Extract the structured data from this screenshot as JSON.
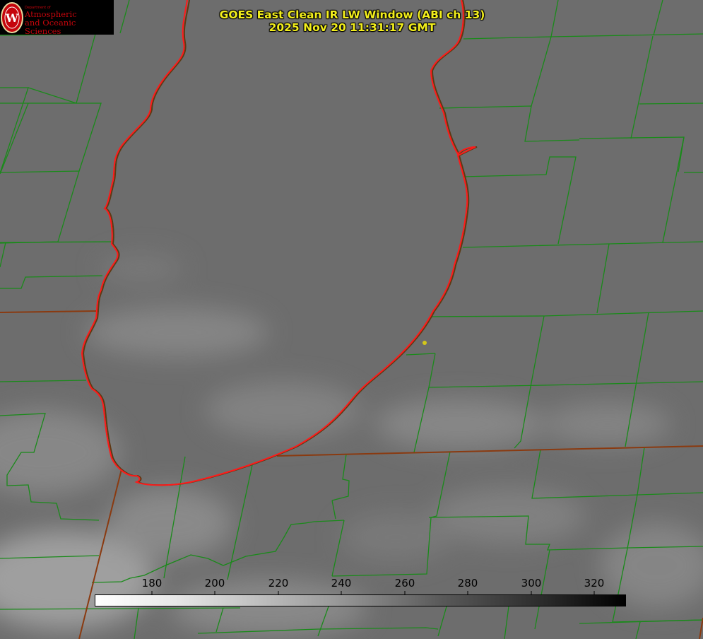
{
  "header": {
    "title_line1": "GOES East Clean IR LW Window (ABI ch 13)",
    "title_line2": "2025 Nov 20 11:31:17 GMT"
  },
  "logo": {
    "dept": "Department of",
    "line1": "Atmospheric",
    "line2": "and Oceanic Sciences",
    "letter": "W"
  },
  "colorbar": {
    "ticks": [
      "180",
      "200",
      "220",
      "240",
      "260",
      "280",
      "300",
      "320"
    ],
    "scale": "grayscale"
  },
  "colors": {
    "county_lines": "#1a8a1a",
    "state_lines": "#8a3a10",
    "lake_outline": "#ff1a1a",
    "title_text": "#f2ee1c",
    "location_marker": "#d4c81a"
  }
}
